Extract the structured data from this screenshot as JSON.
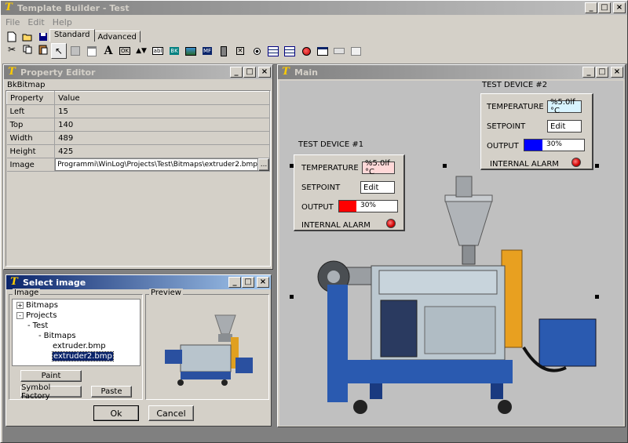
{
  "app": {
    "title": "Template Builder - Test"
  },
  "menu": {
    "file": "File",
    "edit": "Edit",
    "help": "Help"
  },
  "tabs": {
    "standard": "Standard",
    "advanced": "Advanced"
  },
  "toolbar": {
    "text_tool": "A",
    "ok_tool": "OK",
    "abl_tool": "abl",
    "bk_tool": "BK",
    "mf_tool": "MF"
  },
  "property_editor": {
    "title": "Property Editor",
    "object_name": "BkBitmap",
    "col_property": "Property",
    "col_value": "Value",
    "rows": [
      {
        "property": "Left",
        "value": "15"
      },
      {
        "property": "Top",
        "value": "140"
      },
      {
        "property": "Width",
        "value": "489"
      },
      {
        "property": "Height",
        "value": "425"
      },
      {
        "property": "Image",
        "value": "Programmi\\WinLog\\Projects\\Test\\Bitmaps\\extruder2.bmp"
      }
    ],
    "browse_label": "..."
  },
  "select_image": {
    "title": "Select image",
    "image_group": "Image",
    "preview_group": "Preview",
    "tree": [
      {
        "label": "Bitmaps",
        "expander": "+"
      },
      {
        "label": "Projects",
        "expander": "-"
      },
      {
        "label": "Test",
        "expander": "-"
      },
      {
        "label": "Bitmaps",
        "expander": "-"
      },
      {
        "label": "extruder.bmp",
        "expander": ""
      },
      {
        "label": "extruder2.bmp",
        "expander": ""
      }
    ],
    "paint_label": "Paint",
    "symbol_factory_label": "Symbol Factory",
    "paste_label": "Paste",
    "ok_label": "Ok",
    "cancel_label": "Cancel"
  },
  "main": {
    "title": "Main",
    "device1": {
      "heading": "TEST DEVICE #1",
      "temperature_label": "TEMPERATURE",
      "temperature_value": "%5.0lf °C",
      "temperature_color": "#ffd8d8",
      "setpoint_label": "SETPOINT",
      "setpoint_value": "Edit",
      "output_label": "OUTPUT",
      "output_value": "30%",
      "output_fraction": 0.3,
      "output_color": "#ff0000",
      "alarm_label": "INTERNAL ALARM"
    },
    "device2": {
      "heading": "TEST DEVICE #2",
      "temperature_label": "TEMPERATURE",
      "temperature_value": "%5.0lf °C",
      "temperature_color": "#d8f4ff",
      "setpoint_label": "SETPOINT",
      "setpoint_value": "Edit",
      "output_label": "OUTPUT",
      "output_value": "30%",
      "output_fraction": 0.3,
      "output_color": "#0000ff",
      "alarm_label": "INTERNAL ALARM"
    }
  },
  "window_buttons": {
    "minimize": "_",
    "maximize": "□",
    "close": "×"
  }
}
